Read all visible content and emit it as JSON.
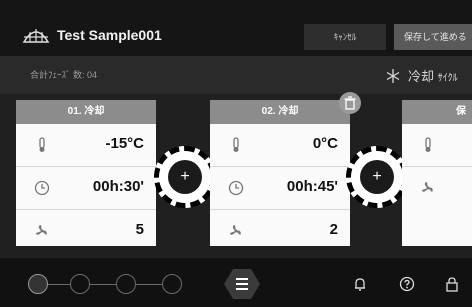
{
  "header": {
    "title": "Test Sample001",
    "cancel_label": "ｷｬﾝｾﾙ",
    "save_label": "保存して進める"
  },
  "subheader": {
    "phase_count": "合計ﾌｪｰｽﾞ 数: 04",
    "cycle_main": "冷却",
    "cycle_small": "ｻｲｸﾙ"
  },
  "cards": [
    {
      "title": "01. 冷却",
      "temperature": "-15°C",
      "time": "00h:30'",
      "fan": "5"
    },
    {
      "title": "02. 冷却",
      "temperature": "0°C",
      "time": "00h:45'",
      "fan": "2"
    },
    {
      "title": "保"
    }
  ],
  "colors": {
    "background": "#1f1f1f",
    "card": "#fafafa",
    "card_header": "#8c8c8c",
    "accent": "#000000"
  },
  "icons": [
    "app-logo-icon",
    "snowflake-icon",
    "thermometer-icon",
    "clock-icon",
    "fan-icon",
    "trash-icon",
    "plus-icon",
    "menu-icon",
    "bell-icon",
    "help-icon",
    "lock-icon"
  ]
}
